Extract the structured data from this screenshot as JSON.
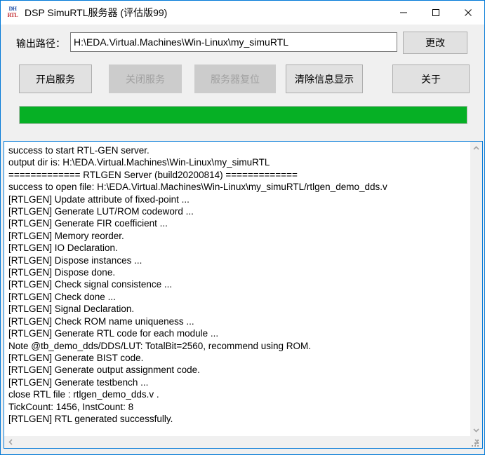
{
  "window": {
    "title": "DSP SimuRTL服务器 (评估版99)",
    "icon_top": "DH",
    "icon_bottom": "RTL",
    "accent_color": "#0078d7",
    "client_background": "#f0f0f0",
    "caption": {
      "minimize": "minimize-icon",
      "maximize": "maximize-icon",
      "close": "close-icon"
    }
  },
  "path_row": {
    "label": "输出路径：",
    "value": "H:\\EDA.Virtual.Machines\\Win-Linux\\my_simuRTL",
    "placeholder": "",
    "change_button": "更改"
  },
  "buttons": [
    {
      "label": "开启服务",
      "enabled": true
    },
    {
      "label": "关闭服务",
      "enabled": false
    },
    {
      "label": "服务器复位",
      "enabled": false
    },
    {
      "label": "清除信息显示",
      "enabled": true
    },
    {
      "label": "关于",
      "enabled": true
    }
  ],
  "progress": {
    "percent": 100,
    "fill_color": "#06b025",
    "track_color": "#e6e6e6"
  },
  "log": {
    "lines": [
      "success to start RTL-GEN server.",
      "output dir is: H:\\EDA.Virtual.Machines\\Win-Linux\\my_simuRTL",
      "============= RTLGEN Server (build20200814) =============",
      "success to open file: H:\\EDA.Virtual.Machines\\Win-Linux\\my_simuRTL/rtlgen_demo_dds.v",
      "[RTLGEN] Update attribute of fixed-point ...",
      "[RTLGEN] Generate LUT/ROM codeword ...",
      "[RTLGEN] Generate FIR coefficient ...",
      "[RTLGEN] Memory reorder.",
      "[RTLGEN] IO Declaration.",
      "[RTLGEN] Dispose instances ...",
      "[RTLGEN] Dispose done.",
      "[RTLGEN] Check signal consistence ...",
      "[RTLGEN] Check done ...",
      "[RTLGEN] Signal Declaration.",
      "[RTLGEN] Check ROM name uniqueness ...",
      "[RTLGEN] Generate RTL code for each module ...",
      "Note @tb_demo_dds/DDS/LUT: TotalBit=2560, recommend using ROM.",
      "[RTLGEN] Generate BIST code.",
      "[RTLGEN] Generate output assignment code.",
      "[RTLGEN] Generate testbench ...",
      "close RTL file : rtlgen_demo_dds.v .",
      "TickCount: 1456, InstCount: 8",
      "[RTLGEN] RTL generated successfully."
    ]
  },
  "scrollbars": {
    "vertical": {
      "up": "▲",
      "down": "▼"
    },
    "horizontal": {
      "left": "◀",
      "right": "▶"
    }
  }
}
